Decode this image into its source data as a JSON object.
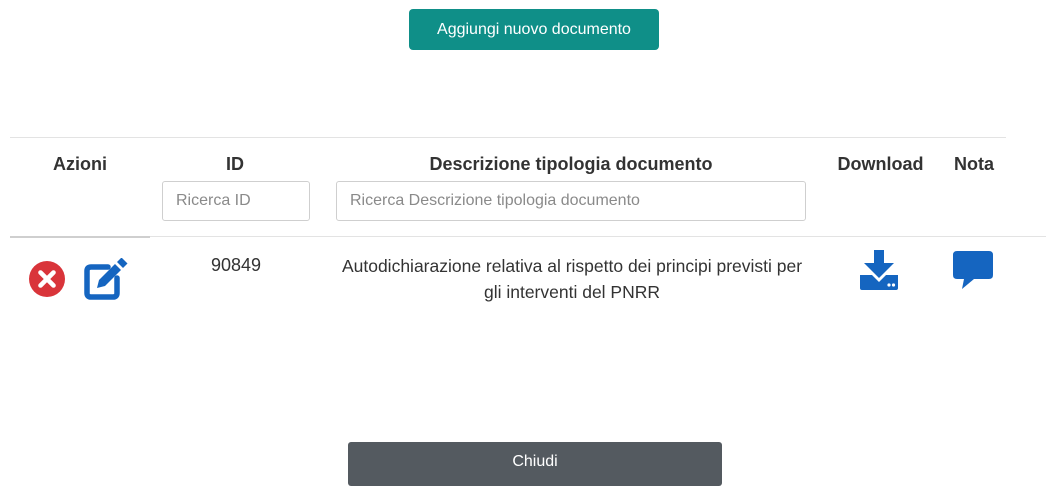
{
  "toolbar": {
    "add_label": "Aggiungi nuovo documento"
  },
  "table": {
    "columns": [
      "Azioni",
      "ID",
      "Descrizione tipologia documento",
      "Download",
      "Nota"
    ],
    "filters": {
      "id_placeholder": "Ricerca ID",
      "desc_placeholder": "Ricerca Descrizione tipologia documento"
    },
    "rows": [
      {
        "id": "90849",
        "description": "Autodichiarazione relativa al rispetto dei principi previsti per gli interventi del PNRR",
        "actions": [
          "delete-icon",
          "edit-icon"
        ],
        "download_icon": "download-icon",
        "note_icon": "comment-icon"
      }
    ]
  },
  "footer": {
    "close_label": "Chiudi"
  },
  "colors": {
    "primary_teal": "#0f8f88",
    "delete_red": "#d9343a",
    "icon_blue": "#1565c0",
    "close_gray": "#545a60"
  }
}
